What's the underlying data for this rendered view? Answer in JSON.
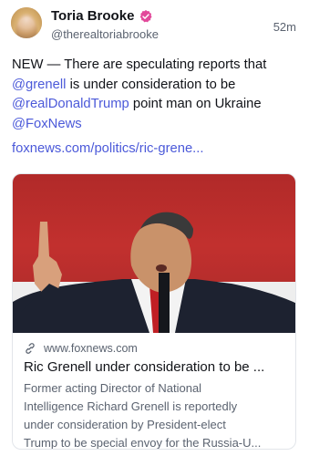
{
  "author": {
    "name": "Toria Brooke",
    "handle": "@therealtoriabrooke",
    "verified_color": "#e2489a",
    "avatar_icon": "profile-photo"
  },
  "timestamp": "52m",
  "post": {
    "part1": "NEW — There are speculating reports that",
    "mention1": "@grenell",
    "part2": "is under consideration to be",
    "mention2": "@realDonaldTrump",
    "part3": "point man on Ukraine",
    "mention3": "@FoxNews",
    "link": "foxnews.com/politics/ric-grene..."
  },
  "card": {
    "domain_icon": "link-icon",
    "domain": "www.foxnews.com",
    "title": "Ric Grenell under consideration to be ...",
    "desc_line1": "Former acting Director of National",
    "desc_line2": "Intelligence Richard Grenell is reportedly",
    "desc_line3": "under consideration by President-elect",
    "desc_line4": "Trump to be special envoy for the Russia-U..."
  },
  "colors": {
    "link": "#4b59d9",
    "muted": "#5b6370",
    "photo_bg": "#b12a29"
  }
}
